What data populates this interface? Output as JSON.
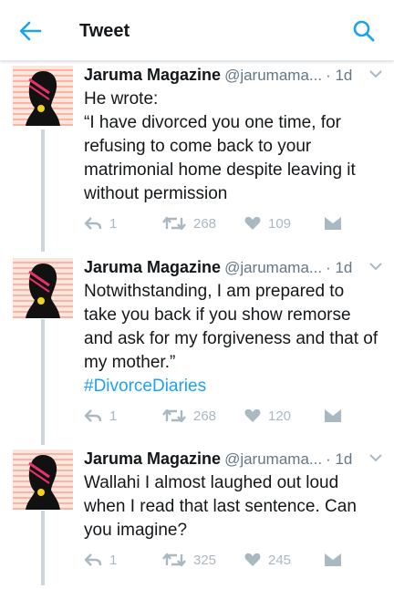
{
  "header": {
    "title": "Tweet"
  },
  "colors": {
    "accent": "#1da1f2",
    "text": "#14171a",
    "secondary": "#657786",
    "icon_grey": "#aab8c2"
  },
  "tweets": [
    {
      "name": "Jaruma Magazine",
      "handle": "@jarumama...",
      "time": "· 1d",
      "lines": [
        "He wrote:",
        "“I have divorced you one time, for",
        "refusing to come back to your",
        "matrimonial home despite leaving it",
        "without permission"
      ],
      "hashtag": "",
      "stats": {
        "replies": "1",
        "retweets": "268",
        "likes": "109"
      }
    },
    {
      "name": "Jaruma Magazine",
      "handle": "@jarumama...",
      "time": "· 1d",
      "lines": [
        "Notwithstanding, I am prepared to",
        "take you back if you show remorse",
        "and ask for my forgiveness and that of",
        "my mother.”"
      ],
      "hashtag": "#DivorceDiaries",
      "stats": {
        "replies": "1",
        "retweets": "268",
        "likes": "120"
      }
    },
    {
      "name": "Jaruma Magazine",
      "handle": "@jarumama...",
      "time": "· 1d",
      "lines": [
        "Wallahi I almost laughed out loud",
        "when I read that last sentence. Can",
        "you imagine?"
      ],
      "hashtag": "",
      "stats": {
        "replies": "1",
        "retweets": "325",
        "likes": "245"
      }
    }
  ]
}
